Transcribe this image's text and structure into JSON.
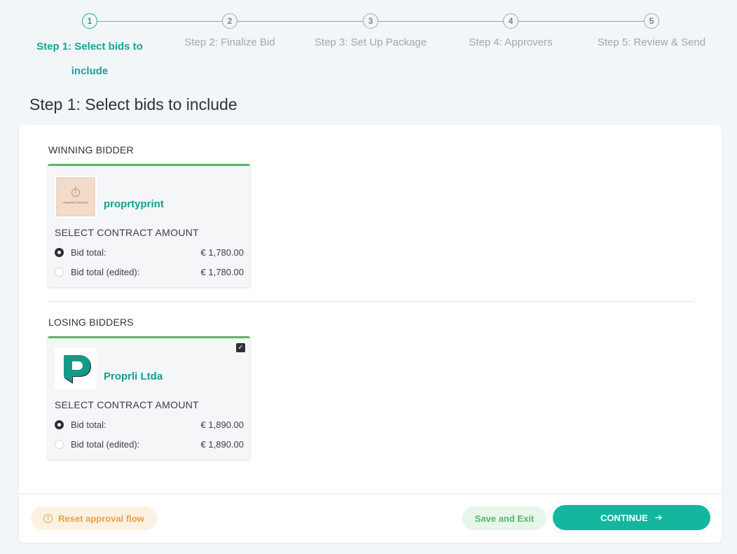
{
  "stepper": {
    "steps": [
      {
        "number": "1",
        "label": "Step 1: Select bids to include"
      },
      {
        "number": "2",
        "label": "Step 2: Finalize Bid"
      },
      {
        "number": "3",
        "label": "Step 3: Set Up Package"
      },
      {
        "number": "4",
        "label": "Step 4: Approvers"
      },
      {
        "number": "5",
        "label": "Step 5: Review & Send"
      }
    ],
    "active_step": 1
  },
  "page": {
    "title": "Step 1: Select bids to include"
  },
  "winning": {
    "section_label": "WINNING BIDDER",
    "bidder_name": "proprtyprint",
    "logo_text": "PROPRTYPRINT",
    "select_label": "SELECT CONTRACT AMOUNT",
    "rows": [
      {
        "label": "Bid total:",
        "amount": "€ 1,780.00",
        "checked": true
      },
      {
        "label": "Bid total (edited):",
        "amount": "€ 1,780.00",
        "checked": false
      }
    ]
  },
  "losing": {
    "section_label": "LOSING BIDDERS",
    "bidder_name": "Proprli Ltda",
    "select_label": "SELECT CONTRACT AMOUNT",
    "included": true,
    "rows": [
      {
        "label": "Bid total:",
        "amount": "€ 1,890.00",
        "checked": true
      },
      {
        "label": "Bid total (edited):",
        "amount": "€ 1,890.00",
        "checked": false
      }
    ]
  },
  "footer": {
    "reset_label": "Reset approval flow",
    "save_label": "Save and Exit",
    "continue_label": "CONTINUE"
  },
  "colors": {
    "accent": "#14b69e",
    "accent_text": "#16a596",
    "card_top_border": "#5cb85c",
    "warning": "#e9a24b"
  },
  "icons": {
    "reset": "warning-circle-icon",
    "continue": "arrow-right-icon",
    "checkbox": "check-icon"
  }
}
